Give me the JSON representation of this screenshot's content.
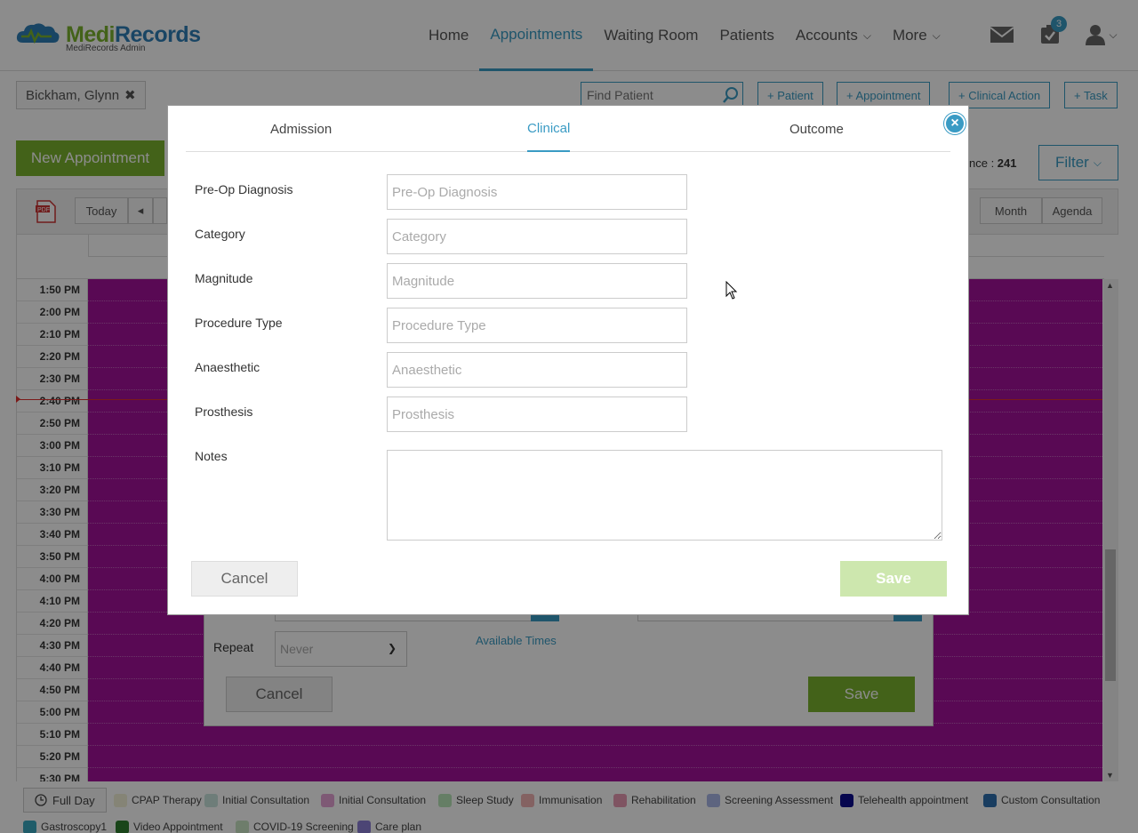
{
  "header": {
    "logo_main_a": "Medi",
    "logo_main_b": "Records",
    "logo_sub": "MediRecords Admin",
    "nav": [
      {
        "label": "Home",
        "active": false
      },
      {
        "label": "Appointments",
        "active": true
      },
      {
        "label": "Waiting Room",
        "active": false
      },
      {
        "label": "Patients",
        "active": false
      },
      {
        "label": "Accounts",
        "active": false,
        "dropdown": true
      },
      {
        "label": "More",
        "active": false,
        "dropdown": true
      }
    ],
    "tasks_badge": "3",
    "icons": [
      "mail-icon",
      "tasks-icon",
      "user-icon"
    ]
  },
  "subbar": {
    "patient_chip": "Bickham, Glynn",
    "find_placeholder": "Find Patient",
    "quick_actions": [
      "+ Patient",
      "+ Appointment",
      "+ Clinical Action",
      "+ Task"
    ]
  },
  "calendar": {
    "new_appointment": "New Appointment",
    "attendance_label": "nce : ",
    "attendance_value": "241",
    "filter": "Filter",
    "toolbar": {
      "today": "Today",
      "prev": "◂",
      "month": "Month",
      "agenda": "Agenda"
    },
    "times": [
      "1:50 PM",
      "2:00 PM",
      "2:10 PM",
      "2:20 PM",
      "2:30 PM",
      "2:40 PM",
      "2:50 PM",
      "3:00 PM",
      "3:10 PM",
      "3:20 PM",
      "3:30 PM",
      "3:40 PM",
      "3:50 PM",
      "4:00 PM",
      "4:10 PM",
      "4:20 PM",
      "4:30 PM",
      "4:40 PM",
      "4:50 PM",
      "5:00 PM",
      "5:10 PM",
      "5:20 PM",
      "5:30 PM"
    ],
    "colors": {
      "slot_fill": "#a3129a",
      "now_line": "#e0302f"
    }
  },
  "legend": {
    "full_day": "Full Day",
    "items": [
      {
        "label": "CPAP Therapy",
        "color": "#f3f1d8"
      },
      {
        "label": "Initial Consultation",
        "color": "#c9e3dc"
      },
      {
        "label": "Initial Consultation",
        "color": "#e6a3d6"
      },
      {
        "label": "Sleep Study",
        "color": "#b9e6b9"
      },
      {
        "label": "Immunisation",
        "color": "#f0b3b3"
      },
      {
        "label": "Rehabilitation",
        "color": "#e89ab3"
      },
      {
        "label": "Screening Assessment",
        "color": "#a9b6e8"
      },
      {
        "label": "Telehealth appointment",
        "color": "#0b0b8f"
      },
      {
        "label": "Custom Consultation",
        "color": "#2f6fb0"
      },
      {
        "label": "Gastroscopy1",
        "color": "#3aa8c0"
      },
      {
        "label": "Video Appointment",
        "color": "#2f7f2f"
      },
      {
        "label": "COVID-19 Screening",
        "color": "#c8e3c3"
      },
      {
        "label": "Care plan",
        "color": "#8a7fd6"
      }
    ]
  },
  "background_modal": {
    "repeat_label": "Repeat",
    "repeat_value": "Never",
    "available_times": "Available Times",
    "cancel": "Cancel",
    "save": "Save"
  },
  "modal": {
    "tabs": [
      "Admission",
      "Clinical",
      "Outcome"
    ],
    "active_tab": "Clinical",
    "fields": [
      {
        "label": "Pre-Op Diagnosis",
        "placeholder": "Pre-Op Diagnosis",
        "value": ""
      },
      {
        "label": "Category",
        "placeholder": "Category",
        "value": ""
      },
      {
        "label": "Magnitude",
        "placeholder": "Magnitude",
        "value": ""
      },
      {
        "label": "Procedure Type",
        "placeholder": "Procedure Type",
        "value": ""
      },
      {
        "label": "Anaesthetic",
        "placeholder": "Anaesthetic",
        "value": ""
      },
      {
        "label": "Prosthesis",
        "placeholder": "Prosthesis",
        "value": ""
      }
    ],
    "notes_label": "Notes",
    "notes_value": "",
    "cancel": "Cancel",
    "save": "Save",
    "colors": {
      "accent": "#3a9bc4",
      "save_disabled": "#cde7ae"
    }
  }
}
